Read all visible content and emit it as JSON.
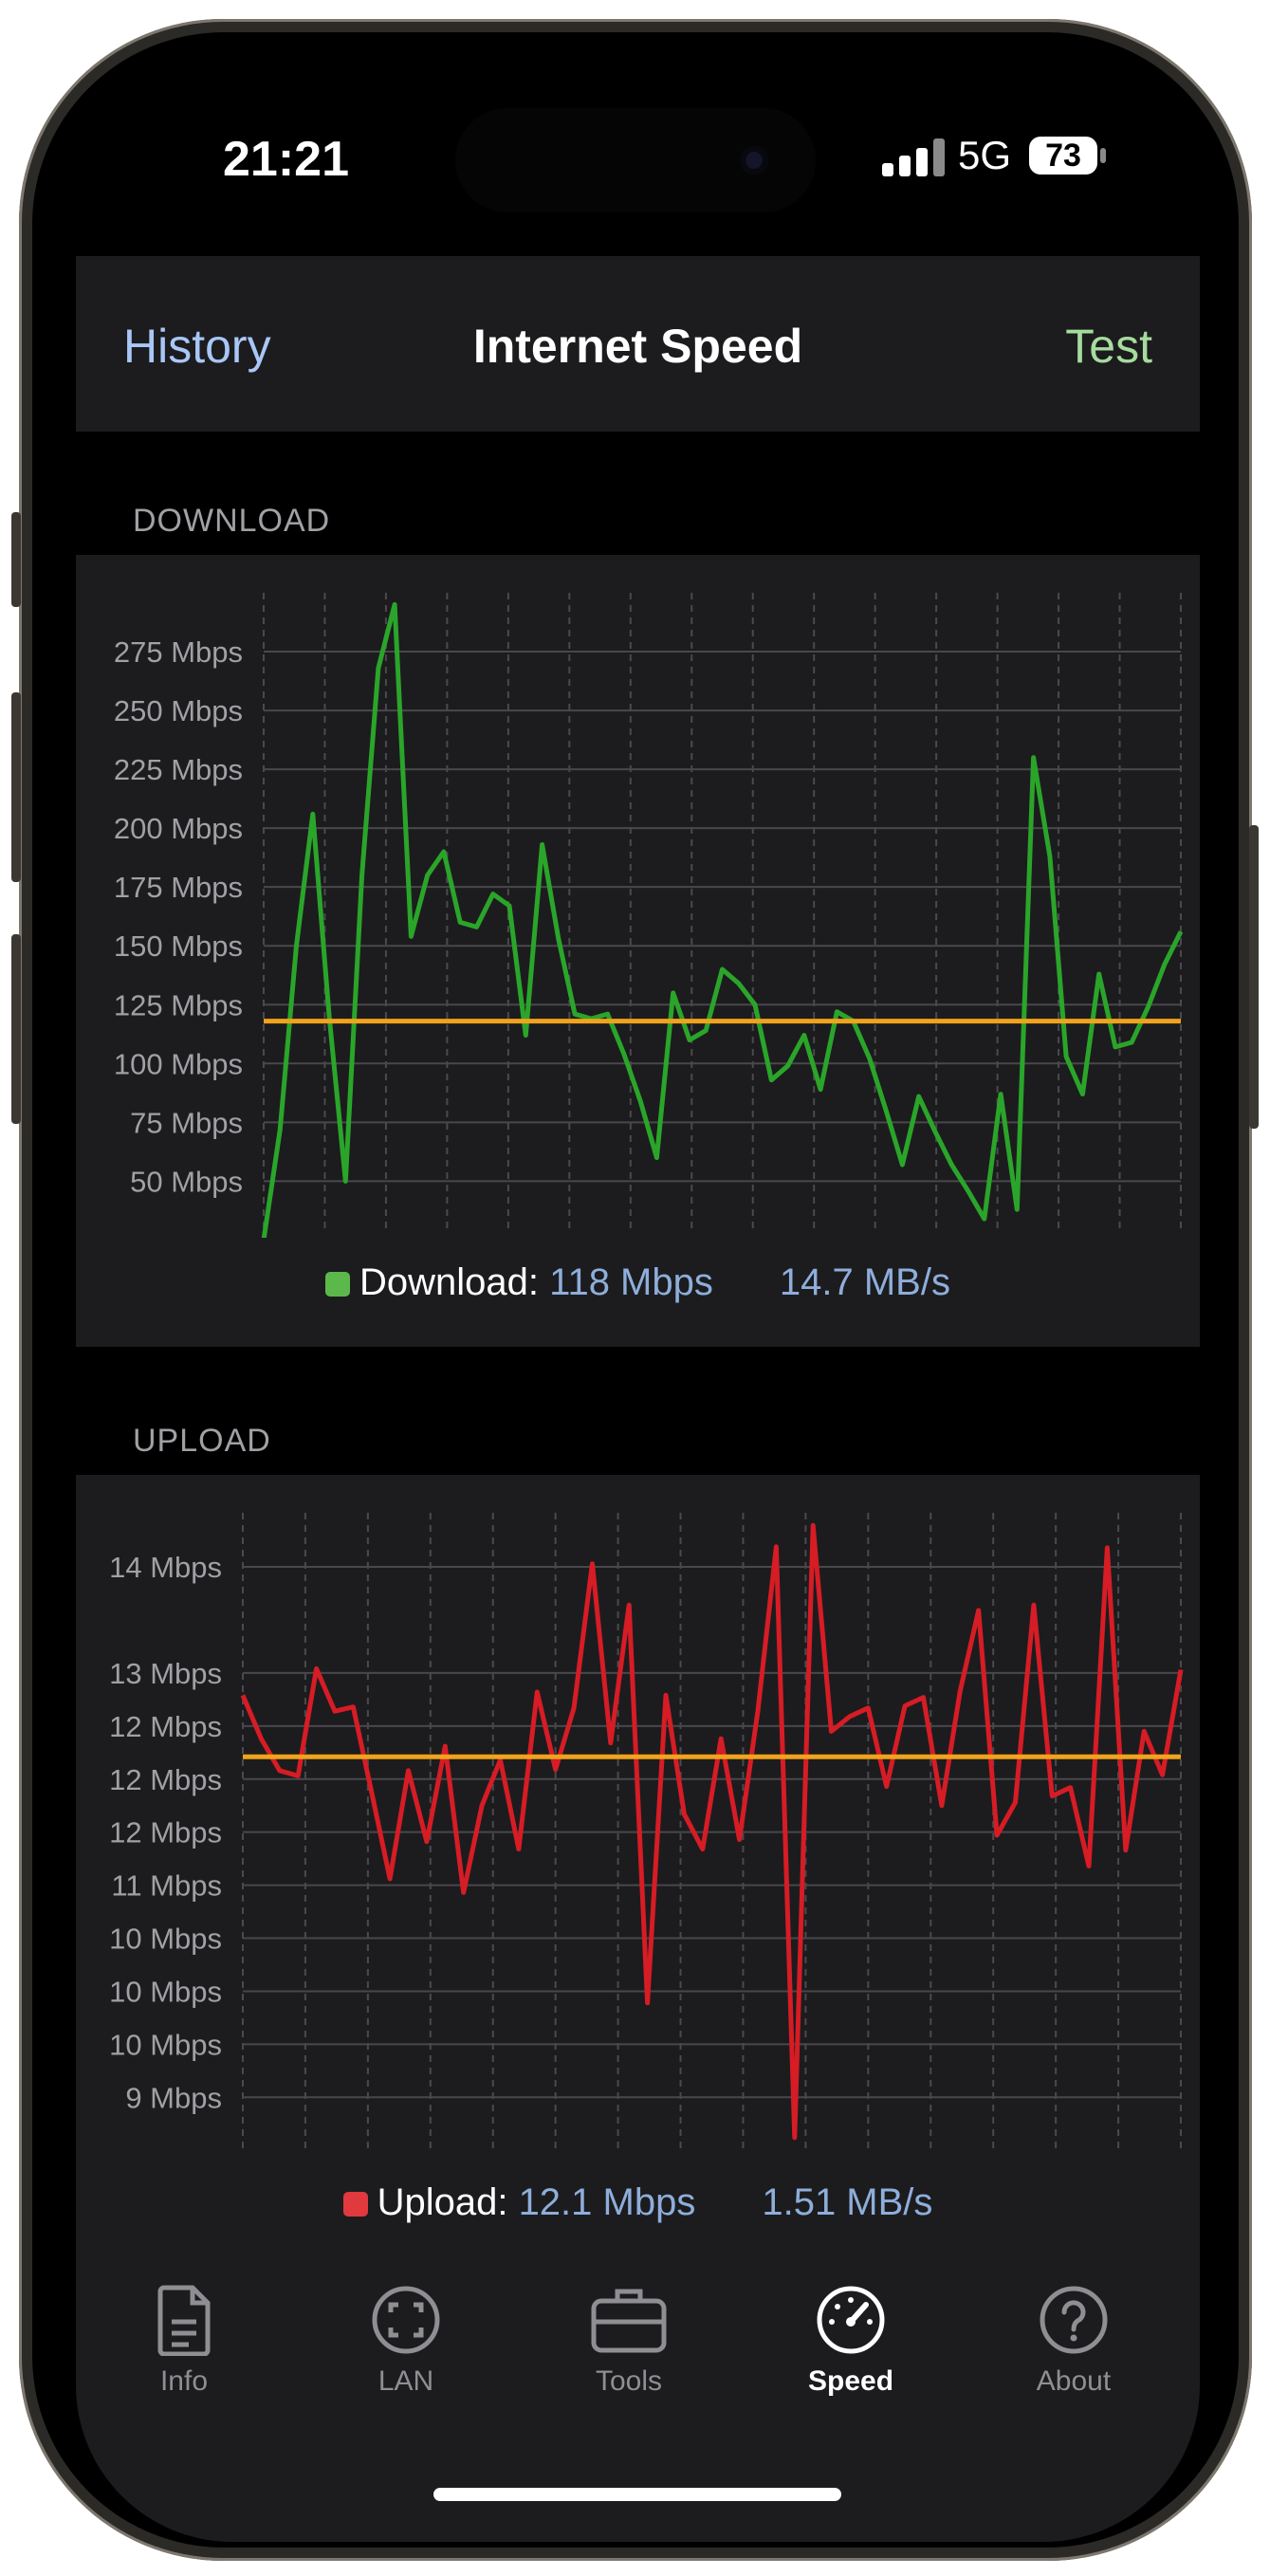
{
  "status_bar": {
    "time": "21:21",
    "network": "5G",
    "battery": "73"
  },
  "nav": {
    "left": "History",
    "title": "Internet Speed",
    "right": "Test"
  },
  "download": {
    "section_label": "DOWNLOAD",
    "legend_label": "Download:",
    "legend_rate": "118 Mbps",
    "legend_bytes": "14.7 MB/s",
    "color": "#2aa52a",
    "average_color": "#f0a31c",
    "swatch_color": "#5cb84a"
  },
  "upload": {
    "section_label": "UPLOAD",
    "legend_label": "Upload:",
    "legend_rate": "12.1 Mbps",
    "legend_bytes": "1.51 MB/s",
    "color": "#d61c25",
    "average_color": "#f0a31c",
    "swatch_color": "#e0393e"
  },
  "chart_data": [
    {
      "type": "line",
      "series": [
        {
          "values": [
            25,
            72,
            150,
            206,
            120,
            50,
            180,
            268,
            295,
            154,
            180,
            190,
            160,
            158,
            172,
            167,
            112,
            193,
            153,
            121,
            119,
            121,
            104,
            84,
            60,
            130,
            110,
            114,
            140,
            134,
            125,
            93,
            99,
            112,
            89,
            122,
            118,
            102,
            80,
            57,
            86,
            71,
            57,
            46,
            34,
            87,
            38,
            230,
            188,
            103,
            87,
            138,
            107,
            109,
            124,
            142,
            156
          ]
        }
      ],
      "average": 118,
      "ylim": [
        30,
        300
      ],
      "y_ticks": [
        50,
        75,
        100,
        125,
        150,
        175,
        200,
        225,
        250,
        275
      ],
      "y_tick_labels": [
        "50 Mbps",
        "75 Mbps",
        "100 Mbps",
        "125 Mbps",
        "150 Mbps",
        "175 Mbps",
        "200 Mbps",
        "225 Mbps",
        "250 Mbps",
        "275 Mbps"
      ],
      "x_gridlines": 15,
      "grid": true
    },
    {
      "type": "line",
      "series": [
        {
          "values": [
            12.79,
            12.38,
            12.08,
            12.03,
            13.04,
            12.64,
            12.68,
            11.88,
            11.06,
            12.08,
            11.41,
            12.31,
            10.93,
            11.75,
            12.18,
            11.34,
            12.82,
            12.09,
            12.67,
            14.03,
            12.34,
            13.64,
            9.89,
            12.79,
            11.67,
            11.34,
            12.38,
            11.43,
            12.64,
            14.19,
            8.62,
            14.39,
            12.45,
            12.59,
            12.67,
            11.93,
            12.69,
            12.77,
            11.75,
            12.83,
            13.59,
            11.47,
            11.78,
            13.64,
            11.84,
            11.92,
            11.18,
            14.18,
            11.33,
            12.45,
            12.04,
            13.03
          ]
        }
      ],
      "average": 12.21,
      "ylim": [
        8.52,
        14.51
      ],
      "y_ticks": [
        9.0,
        9.5,
        10.0,
        10.5,
        11.0,
        11.5,
        12.0,
        12.5,
        13.0,
        14.0
      ],
      "y_tick_labels": [
        "9 Mbps",
        "10 Mbps",
        "10 Mbps",
        "10 Mbps",
        "11 Mbps",
        "12 Mbps",
        "12 Mbps",
        "12 Mbps",
        "13 Mbps",
        "14 Mbps"
      ],
      "x_gridlines": 15,
      "grid": true
    }
  ],
  "tabs": [
    {
      "label": "Info",
      "icon": "document-icon"
    },
    {
      "label": "LAN",
      "icon": "lan-icon"
    },
    {
      "label": "Tools",
      "icon": "toolbox-icon"
    },
    {
      "label": "Speed",
      "icon": "speedometer-icon",
      "active": true
    },
    {
      "label": "About",
      "icon": "question-icon"
    }
  ]
}
